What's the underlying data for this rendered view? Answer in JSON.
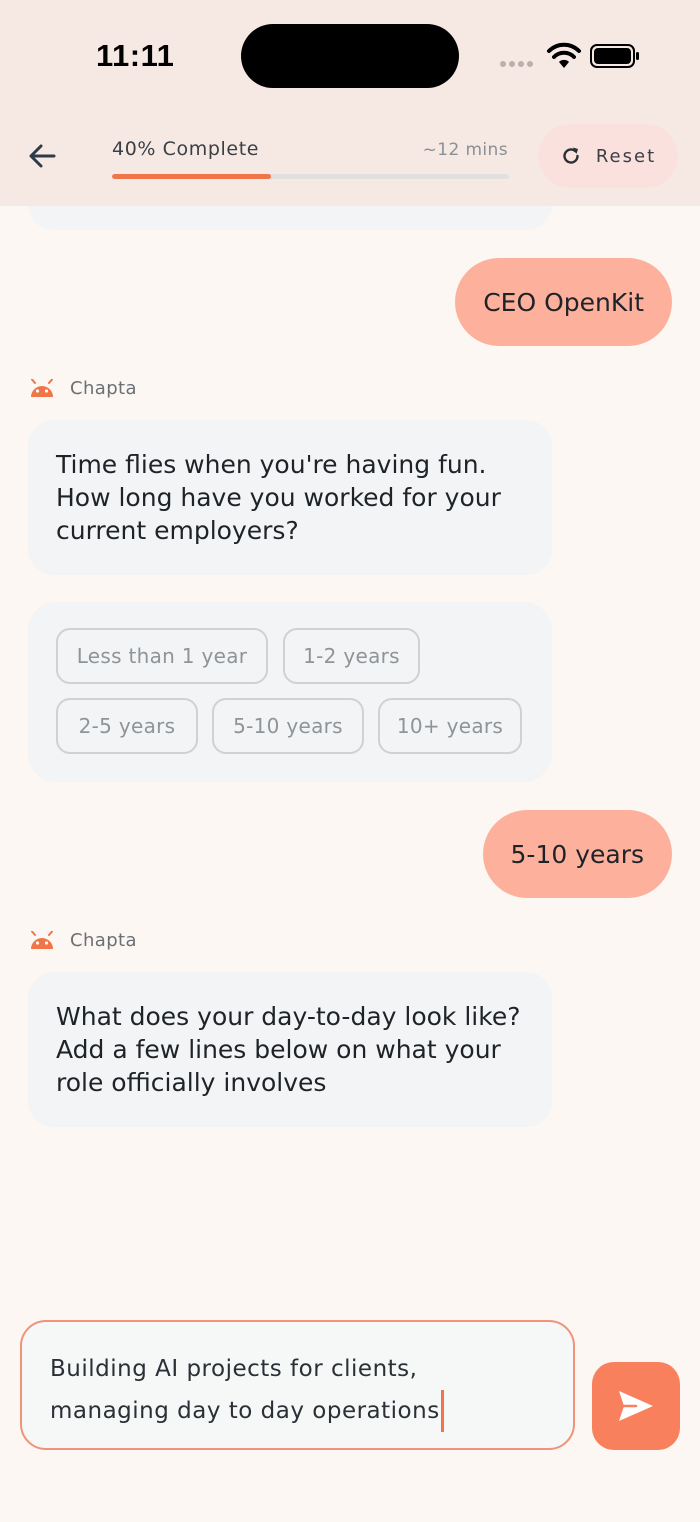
{
  "status_bar": {
    "time": "11:11"
  },
  "header": {
    "progress_label": "40% Complete",
    "progress_value": 0.4,
    "time_estimate": "~12 mins",
    "reset_label": "Reset"
  },
  "messages": {
    "user_1": "CEO OpenKit",
    "bot_1": {
      "sender": "Chapta",
      "text": "Time flies when you're having fun. How long have you worked for your current employers?"
    },
    "options": [
      "Less than 1 year",
      "1-2 years",
      "2-5 years",
      "5-10 years",
      "10+ years"
    ],
    "user_2": "5-10 years",
    "bot_2": {
      "sender": "Chapta",
      "text": "What does your day-to-day look like? Add a few lines below on what your role officially involves"
    }
  },
  "composer": {
    "line_1": "Building AI projects for clients,",
    "line_2": "managing day to day operations"
  },
  "colors": {
    "accent": "#f0764a",
    "user_bubble": "#fdb19d",
    "bot_bubble": "#f2f4f5",
    "background": "#fdf7f3",
    "header_bg": "#f6e9e4"
  }
}
